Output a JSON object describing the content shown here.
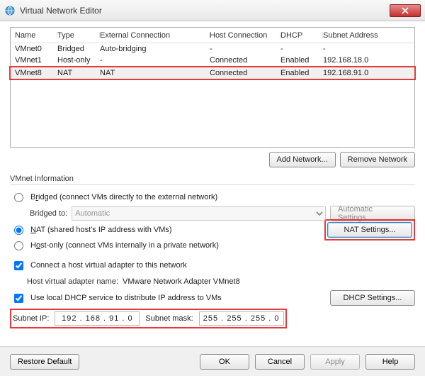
{
  "window": {
    "title": "Virtual Network Editor"
  },
  "table": {
    "headers": [
      "Name",
      "Type",
      "External Connection",
      "Host Connection",
      "DHCP",
      "Subnet Address"
    ],
    "rows": [
      {
        "name": "VMnet0",
        "type": "Bridged",
        "ext": "Auto-bridging",
        "host": "-",
        "dhcp": "-",
        "subnet": "-"
      },
      {
        "name": "VMnet1",
        "type": "Host-only",
        "ext": "-",
        "host": "Connected",
        "dhcp": "Enabled",
        "subnet": "192.168.18.0"
      },
      {
        "name": "VMnet8",
        "type": "NAT",
        "ext": "NAT",
        "host": "Connected",
        "dhcp": "Enabled",
        "subnet": "192.168.91.0"
      }
    ]
  },
  "buttons": {
    "add_network": "Add Network...",
    "remove_network": "Remove Network",
    "automatic_settings": "Automatic Settings...",
    "nat_settings": "NAT Settings...",
    "dhcp_settings": "DHCP Settings...",
    "restore_default": "Restore Default",
    "ok": "OK",
    "cancel": "Cancel",
    "apply": "Apply",
    "help": "Help"
  },
  "info": {
    "group_label": "VMnet Information",
    "bridged": {
      "label_pre": "B",
      "label_u": "r",
      "label_post": "idged (connect VMs directly to the external network)",
      "bridged_to_label": "Bridged to:",
      "bridged_to_value": "Automatic"
    },
    "nat": {
      "label": "NAT (shared host's IP address with VMs)",
      "u": "N"
    },
    "hostonly": {
      "label_pre": "H",
      "label_u": "o",
      "label_post": "st-only (connect VMs internally in a private network)"
    },
    "connect_adapter": "Connect a host virtual adapter to this network",
    "adapter_name_label": "Host virtual adapter name:",
    "adapter_name": "VMware Network Adapter VMnet8",
    "use_dhcp": "Use local DHCP service to distribute IP address to VMs",
    "subnet_ip_label": "Subnet IP:",
    "subnet_ip": "192 . 168 . 91  .  0",
    "subnet_mask_label": "Subnet mask:",
    "subnet_mask": "255 . 255 . 255 .  0"
  },
  "colors": {
    "highlight": "#e63a3a"
  }
}
